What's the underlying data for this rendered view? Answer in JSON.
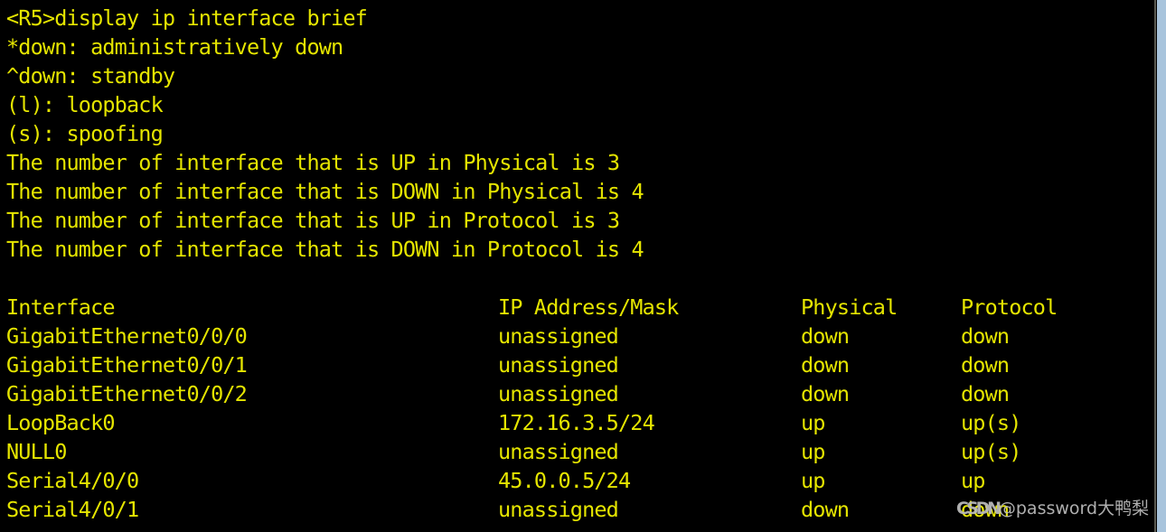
{
  "terminal": {
    "prompt_line": "<R5>display ip interface brief",
    "legend": [
      "*down: administratively down",
      "^down: standby",
      "(l): loopback",
      "(s): spoofing"
    ],
    "summary": [
      "The number of interface that is UP in Physical is 3",
      "The number of interface that is DOWN in Physical is 4",
      "The number of interface that is UP in Protocol is 3",
      "The number of interface that is DOWN in Protocol is 4"
    ],
    "table": {
      "headers": {
        "interface": "Interface",
        "ip_address_mask": "IP Address/Mask",
        "physical": "Physical",
        "protocol": "Protocol"
      },
      "rows": [
        {
          "interface": "GigabitEthernet0/0/0",
          "ip_address_mask": "unassigned",
          "physical": "down",
          "protocol": "down"
        },
        {
          "interface": "GigabitEthernet0/0/1",
          "ip_address_mask": "unassigned",
          "physical": "down",
          "protocol": "down"
        },
        {
          "interface": "GigabitEthernet0/0/2",
          "ip_address_mask": "unassigned",
          "physical": "down",
          "protocol": "down"
        },
        {
          "interface": "LoopBack0",
          "ip_address_mask": "172.16.3.5/24",
          "physical": "up",
          "protocol": "up(s)"
        },
        {
          "interface": "NULL0",
          "ip_address_mask": "unassigned",
          "physical": "up",
          "protocol": "up(s)"
        },
        {
          "interface": "Serial4/0/0",
          "ip_address_mask": "45.0.0.5/24",
          "physical": "up",
          "protocol": "up"
        },
        {
          "interface": "Serial4/0/1",
          "ip_address_mask": "unassigned",
          "physical": "down",
          "protocol": "down"
        }
      ]
    },
    "colors": {
      "background": "#000000",
      "text": "#e5e500",
      "scrollbar_thumb": "#a8c4dc",
      "scrollbar_divider": "#5a5a52",
      "watermark": "#b9b9b9"
    }
  },
  "watermark": {
    "prefix": "CSDN",
    "handle": "@password大鸭梨"
  }
}
